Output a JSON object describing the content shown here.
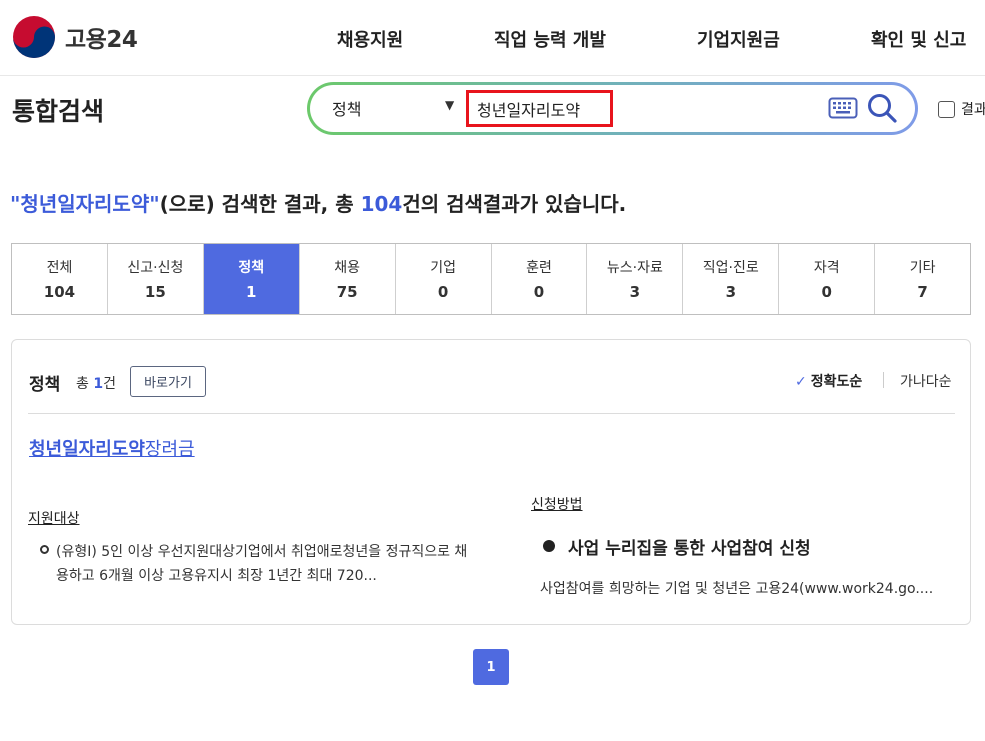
{
  "header": {
    "logo_text": "고용24",
    "nav": [
      "채용지원",
      "직업 능력 개발",
      "기업지원금",
      "확인 및 신고"
    ]
  },
  "search": {
    "page_title": "통합검색",
    "category": "정책",
    "query": "청년일자리도약",
    "checkbox_label": "결과"
  },
  "summary": {
    "keyword": "\"청년일자리도약\"",
    "mid": "(으로) 검색한 결과, 총 ",
    "count": "104",
    "end": "건의 검색결과가 있습니다."
  },
  "tabs": [
    {
      "label": "전체",
      "count": "104"
    },
    {
      "label": "신고·신청",
      "count": "15"
    },
    {
      "label": "정책",
      "count": "1",
      "active": true
    },
    {
      "label": "채용",
      "count": "75"
    },
    {
      "label": "기업",
      "count": "0"
    },
    {
      "label": "훈련",
      "count": "0"
    },
    {
      "label": "뉴스·자료",
      "count": "3"
    },
    {
      "label": "직업·진로",
      "count": "3"
    },
    {
      "label": "자격",
      "count": "0"
    },
    {
      "label": "기타",
      "count": "7"
    }
  ],
  "result": {
    "section_title": "정책",
    "total_prefix": "총 ",
    "total_count": "1",
    "total_suffix": "건",
    "goto_label": "바로가기",
    "sort_accuracy": "정확도순",
    "sort_alpha": "가나다순",
    "policy_highlight": "청년일자리도약",
    "policy_rest": "장려금",
    "target_label": "지원대상",
    "target_text": "(유형I) 5인 이상 우선지원대상기업에서 취업애로청년을 정규직으로 채용하고 6개월 이상 고용유지시 최장 1년간 최대 720...",
    "method_label": "신청방법",
    "method_title": "사업 누리집을 통한 사업참여 신청",
    "method_desc": "사업참여를 희망하는 기업 및 청년은 고용24(www.work24.go...."
  },
  "pagination": {
    "current": "1"
  },
  "colors": {
    "accent": "#4f6ae0",
    "highlight_box": "#e8141c",
    "link": "#3c5bd9"
  }
}
